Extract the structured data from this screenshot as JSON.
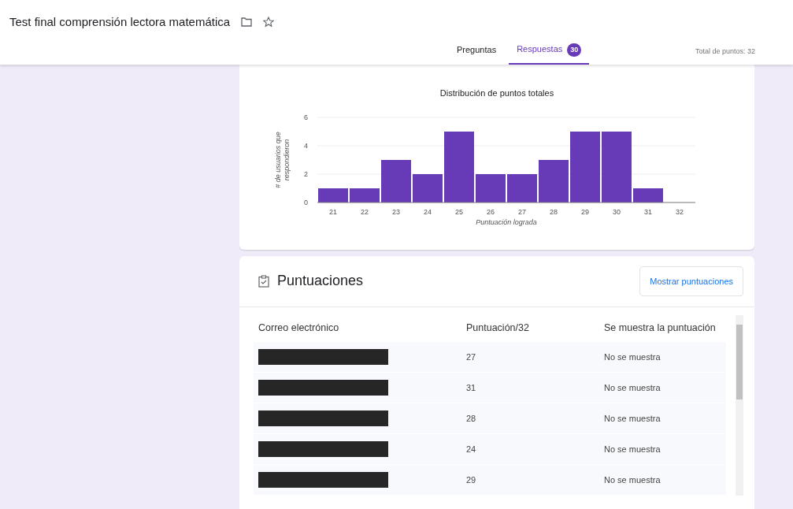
{
  "header": {
    "title": "Test final comprensión lectora matemática",
    "total_points": "Total de puntos: 32"
  },
  "tabs": [
    {
      "label": "Preguntas",
      "selected": false
    },
    {
      "label": "Respuestas",
      "selected": true,
      "count": "30"
    }
  ],
  "chart_card": {
    "chart_data": {
      "type": "bar",
      "title": "Distribución de puntos totales",
      "xlabel": "Puntuación lograda",
      "ylabel": "# de usuarios que respondieron",
      "categories": [
        "21",
        "22",
        "23",
        "24",
        "25",
        "26",
        "27",
        "28",
        "29",
        "30",
        "31",
        "32"
      ],
      "series": [
        {
          "color": "#673ab7",
          "values": [
            1,
            1,
            3,
            2,
            5,
            2,
            2,
            3,
            5,
            5,
            1,
            0
          ]
        }
      ],
      "ylim": [
        0,
        6
      ],
      "yticks": [
        0,
        2,
        4,
        6
      ]
    }
  },
  "scores_card": {
    "title": "Puntuaciones",
    "button": "Mostrar puntuaciones",
    "columns": [
      "Correo electrónico",
      "Puntuación/32",
      "Se muestra la puntuación"
    ],
    "rows": [
      {
        "email_redacted": true,
        "score": "27",
        "shown": "No se muestra"
      },
      {
        "email_redacted": true,
        "score": "31",
        "shown": "No se muestra"
      },
      {
        "email_redacted": true,
        "score": "28",
        "shown": "No se muestra"
      },
      {
        "email_redacted": true,
        "score": "24",
        "shown": "No se muestra"
      },
      {
        "email_redacted": true,
        "score": "29",
        "shown": "No se muestra"
      }
    ]
  }
}
